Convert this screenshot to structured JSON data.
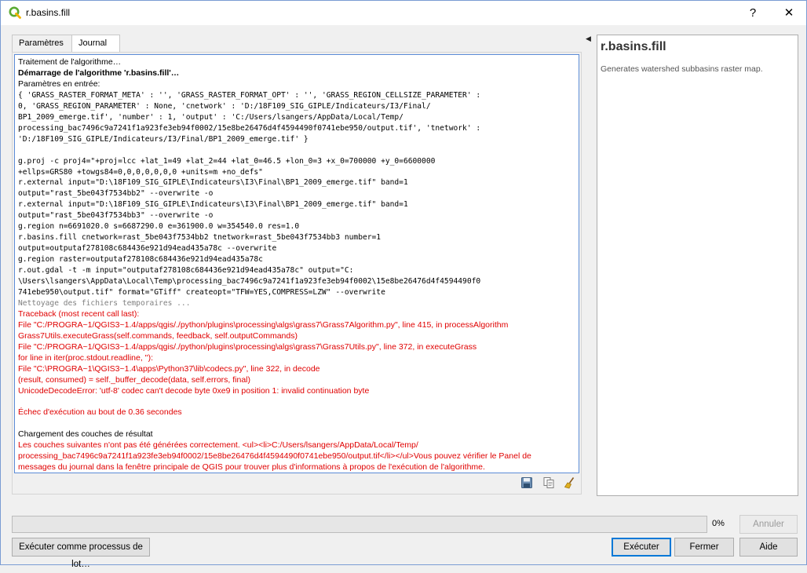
{
  "window": {
    "title": "r.basins.fill",
    "help_button": "?",
    "close_button": "✕"
  },
  "tabs": [
    {
      "label": "Paramètres",
      "active": false
    },
    {
      "label": "Journal",
      "active": true
    }
  ],
  "log": {
    "lines": [
      {
        "text": "Traitement de l'algorithme…",
        "style": "plain"
      },
      {
        "text": "Démarrage de l'algorithme 'r.basins.fill'…",
        "style": "bold"
      },
      {
        "text": "Paramètres en entrée:",
        "style": "plain"
      },
      {
        "text": "{ 'GRASS_RASTER_FORMAT_META' : '', 'GRASS_RASTER_FORMAT_OPT' : '', 'GRASS_REGION_CELLSIZE_PARAMETER' :",
        "style": "mono"
      },
      {
        "text": "0, 'GRASS_REGION_PARAMETER' : None, 'cnetwork' : 'D:/18F109_SIG_GIPLE/Indicateurs/I3/Final/",
        "style": "mono"
      },
      {
        "text": "BP1_2009_emerge.tif', 'number' : 1, 'output' : 'C:/Users/lsangers/AppData/Local/Temp/",
        "style": "mono"
      },
      {
        "text": "processing_bac7496c9a7241f1a923fe3eb94f0002/15e8be26476d4f4594490f0741ebe950/output.tif', 'tnetwork' :",
        "style": "mono"
      },
      {
        "text": "'D:/18F109_SIG_GIPLE/Indicateurs/I3/Final/BP1_2009_emerge.tif' }",
        "style": "mono"
      },
      {
        "text": "",
        "style": "blank"
      },
      {
        "text": "g.proj -c proj4=\"+proj=lcc +lat_1=49 +lat_2=44 +lat_0=46.5 +lon_0=3 +x_0=700000 +y_0=6600000",
        "style": "mono"
      },
      {
        "text": "+ellps=GRS80 +towgs84=0,0,0,0,0,0,0 +units=m +no_defs\"",
        "style": "mono"
      },
      {
        "text": "r.external input=\"D:\\18F109_SIG_GIPLE\\Indicateurs\\I3\\Final\\BP1_2009_emerge.tif\" band=1",
        "style": "mono"
      },
      {
        "text": "output=\"rast_5be043f7534bb2\" --overwrite -o",
        "style": "mono"
      },
      {
        "text": "r.external input=\"D:\\18F109_SIG_GIPLE\\Indicateurs\\I3\\Final\\BP1_2009_emerge.tif\" band=1",
        "style": "mono"
      },
      {
        "text": "output=\"rast_5be043f7534bb3\" --overwrite -o",
        "style": "mono"
      },
      {
        "text": "g.region n=6691020.0 s=6687290.0 e=361900.0 w=354540.0 res=1.0",
        "style": "mono"
      },
      {
        "text": "r.basins.fill cnetwork=rast_5be043f7534bb2 tnetwork=rast_5be043f7534bb3 number=1",
        "style": "mono"
      },
      {
        "text": "output=outputaf278108c684436e921d94ead435a78c --overwrite",
        "style": "mono"
      },
      {
        "text": "g.region raster=outputaf278108c684436e921d94ead435a78c",
        "style": "mono"
      },
      {
        "text": "r.out.gdal -t -m input=\"outputaf278108c684436e921d94ead435a78c\" output=\"C:",
        "style": "mono"
      },
      {
        "text": "\\Users\\lsangers\\AppData\\Local\\Temp\\processing_bac7496c9a7241f1a923fe3eb94f0002\\15e8be26476d4f4594490f0",
        "style": "mono"
      },
      {
        "text": "741ebe950\\output.tif\" format=\"GTiff\" createopt=\"TFW=YES,COMPRESS=LZW\" --overwrite",
        "style": "mono"
      },
      {
        "text": "Nettoyage des fichiers temporaires ...",
        "style": "mono-gray"
      },
      {
        "text": "Traceback (most recent call last):",
        "style": "red"
      },
      {
        "text": "File \"C:/PROGRA~1/QGIS3~1.4/apps/qgis/./python/plugins\\processing\\algs\\grass7\\Grass7Algorithm.py\", line 415, in processAlgorithm",
        "style": "red"
      },
      {
        "text": "Grass7Utils.executeGrass(self.commands, feedback, self.outputCommands)",
        "style": "red"
      },
      {
        "text": "File \"C:/PROGRA~1/QGIS3~1.4/apps/qgis/./python/plugins\\processing\\algs\\grass7\\Grass7Utils.py\", line 372, in executeGrass",
        "style": "red"
      },
      {
        "text": "for line in iter(proc.stdout.readline, ''):",
        "style": "red"
      },
      {
        "text": "File \"C:\\PROGRA~1\\QGIS3~1.4\\apps\\Python37\\lib\\codecs.py\", line 322, in decode",
        "style": "red"
      },
      {
        "text": "(result, consumed) = self._buffer_decode(data, self.errors, final)",
        "style": "red"
      },
      {
        "text": "UnicodeDecodeError: 'utf-8' codec can't decode byte 0xe9 in position 1: invalid continuation byte",
        "style": "red"
      },
      {
        "text": "",
        "style": "blank"
      },
      {
        "text": "Échec d'exécution au bout de 0.36 secondes",
        "style": "red"
      },
      {
        "text": "",
        "style": "blank"
      },
      {
        "text": "Chargement des couches de résultat",
        "style": "plain"
      },
      {
        "text": "Les couches suivantes n'ont pas été générées correctement. <ul><li>C:/Users/lsangers/AppData/Local/Temp/",
        "style": "red"
      },
      {
        "text": "processing_bac7496c9a7241f1a923fe3eb94f0002/15e8be26476d4f4594490f0741ebe950/output.tif</li></ul>Vous pouvez vérifier le Panel de",
        "style": "red"
      },
      {
        "text": "messages du journal dans la fenêtre principale de QGIS pour trouver plus d'informations à propos de l'exécution de l'algorithme.",
        "style": "red"
      }
    ]
  },
  "help_panel": {
    "title": "r.basins.fill",
    "description": "Generates watershed subbasins raster map."
  },
  "progress": {
    "value": 0,
    "label": "0%"
  },
  "buttons": {
    "cancel": "Annuler",
    "batch": "Exécuter comme processus de lot…",
    "run": "Exécuter",
    "close": "Fermer",
    "help": "Aide"
  },
  "icons": {
    "app": "qgis-logo-icon",
    "save_log": "save-icon",
    "copy_log": "copy-icon",
    "clear_log": "broom-icon",
    "collapse": "triangle-left-icon"
  },
  "colors": {
    "error_text": "#e00000",
    "accent": "#0078d7",
    "qgis_green": "#5aaa32"
  }
}
